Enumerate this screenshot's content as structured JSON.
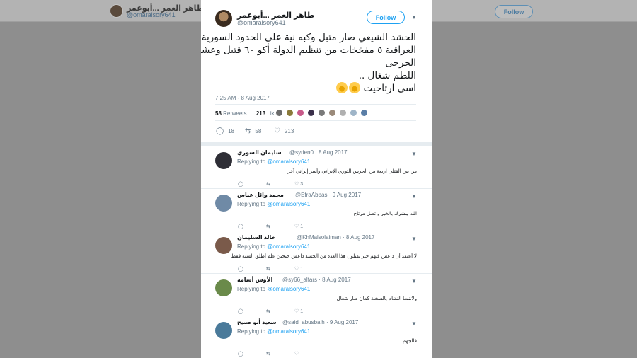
{
  "topbar": {
    "name": "طاهر العمر ...أبوعمر",
    "handle": "@omaralsory641",
    "follow_label": "Follow"
  },
  "tweet": {
    "author_name": "طاهر العمر ...أبوعمر",
    "author_handle": "@omaralsory641",
    "follow_label": "Follow",
    "text_lines": [
      "الحشد الشيعي صار متبل وكبه نية على الحدود السورية",
      "العراقية ٥ مفخخات من تنظيم الدولة أكو ٦٠ قتيل وعشرات",
      "الجرحى",
      "اللطم شغال ..",
      "اسى ارتاحيت"
    ],
    "timestamp": "7:25 AM - 8 Aug 2017",
    "retweets_count": "58",
    "retweets_label": "Retweets",
    "likes_count": "213",
    "likes_label": "Likes",
    "actions": {
      "replies": "18",
      "retweets": "58",
      "likes": "213"
    },
    "liker_colors": [
      "#6b6b6b",
      "#8a7a3a",
      "#c85a8a",
      "#3a2f4a",
      "#7a7a7a",
      "#9a8a7a",
      "#b0b0b0",
      "#9fb5c8",
      "#5a7ea6"
    ]
  },
  "replies": [
    {
      "name": "سليمان السوري",
      "handle": "@syrien0",
      "date": "· 8 Aug 2017",
      "replying_prefix": "Replying to",
      "replying_to": "@omaralsory641",
      "text": "من بين القتلى اربعة من الحرس الثوري الإيراني وأسر إيراني آخر",
      "reply_count": "",
      "retweet_count": "",
      "like_count": "3",
      "avatar_color": "#2e2e36"
    },
    {
      "name": "محمد وائل عباس",
      "handle": "@EfraAbbas",
      "date": "· 9 Aug 2017",
      "replying_prefix": "Replying to",
      "replying_to": "@omaralsory641",
      "text": "الله يبشرك بالخير و تصل مرتاح",
      "reply_count": "",
      "retweet_count": "",
      "like_count": "1",
      "avatar_color": "#6f8aa6"
    },
    {
      "name": "خالد السليمان",
      "handle": "@KhMalsolaiman",
      "date": "· 8 Aug 2017",
      "replying_prefix": "Replying to",
      "replying_to": "@omaralsory641",
      "text": "لا أعتقد أن داعش فيهم خير يقتلون هذا العدد من الحشد داعش حيجين علم أطلق السنة فقط",
      "reply_count": "",
      "retweet_count": "",
      "like_count": "1",
      "avatar_color": "#7a5a4a"
    },
    {
      "name": "الأوس أسامة",
      "handle": "@sy66_alfars",
      "date": "· 8 Aug 2017",
      "replying_prefix": "Replying to",
      "replying_to": "@omaralsory641",
      "text": "ولاتنسا النظام بالسخنة كمان صار شغال",
      "reply_count": "",
      "retweet_count": "",
      "like_count": "1",
      "avatar_color": "#6a8a4a"
    },
    {
      "name": "سعيد أبو صبيح",
      "handle": "@said_abusbaih",
      "date": "· 9 Aug 2017",
      "replying_prefix": "Replying to",
      "replying_to": "@omaralsory641",
      "text": "فالجهم ..",
      "reply_count": "",
      "retweet_count": "",
      "like_count": "",
      "avatar_color": "#4a7a9a"
    }
  ]
}
